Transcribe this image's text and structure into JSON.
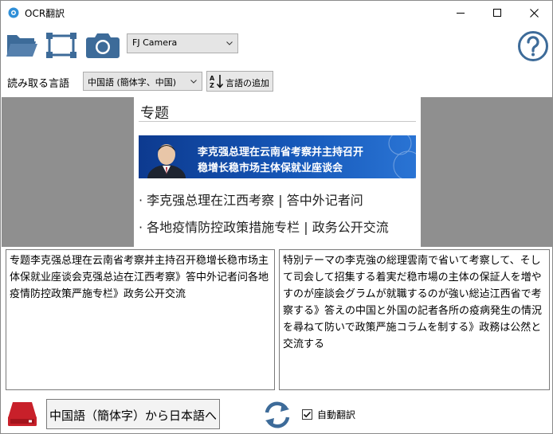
{
  "window": {
    "title": "OCR翻訳"
  },
  "toolbar": {
    "camera_select": "FJ Camera",
    "read_lang_label": "読み取る言語",
    "read_lang_select": "中国語 (簡体字、中国)",
    "add_lang_label": "言語の追加"
  },
  "preview": {
    "title": "专题",
    "banner_line1": "李克强总理在云南省考察并主持召开",
    "banner_line2": "稳增长稳市场主体保就业座谈会",
    "item1": "· 李克强总理在江西考察 | 答中外记者问",
    "item2": "· 各地疫情防控政策措施专栏 | 政务公开交流"
  },
  "ocr_text": "专题李克强总理在云南省考察并主持召开稳增长稳市场主体保就业座谈会克强总迠在江西考察》答中外记者问各地疫情防控政策严施专栏》政务公开交流",
  "translated_text": "特別テーマの李克強の総理雲南で省いて考察して、そして司会して招集する着実だ稳市場の主体の保証人を増やすのが座談会グラムが就職するのが強い総迠江西省で考察する》答えの中国と外国の記者各所の疫病発生の情況を尋ねて防いで政策严施コラムを制する》政務は公然と交流する",
  "bottom": {
    "direction_label": "中国語（簡体字）から日本語へ",
    "auto_translate_label": "自動翻訳",
    "auto_translate_checked": true
  },
  "colors": {
    "preview_bg": "#8f8f8f",
    "banner_blue": "#1557b8",
    "save_red": "#c8202a",
    "icon_blue": "#3d6b99"
  }
}
